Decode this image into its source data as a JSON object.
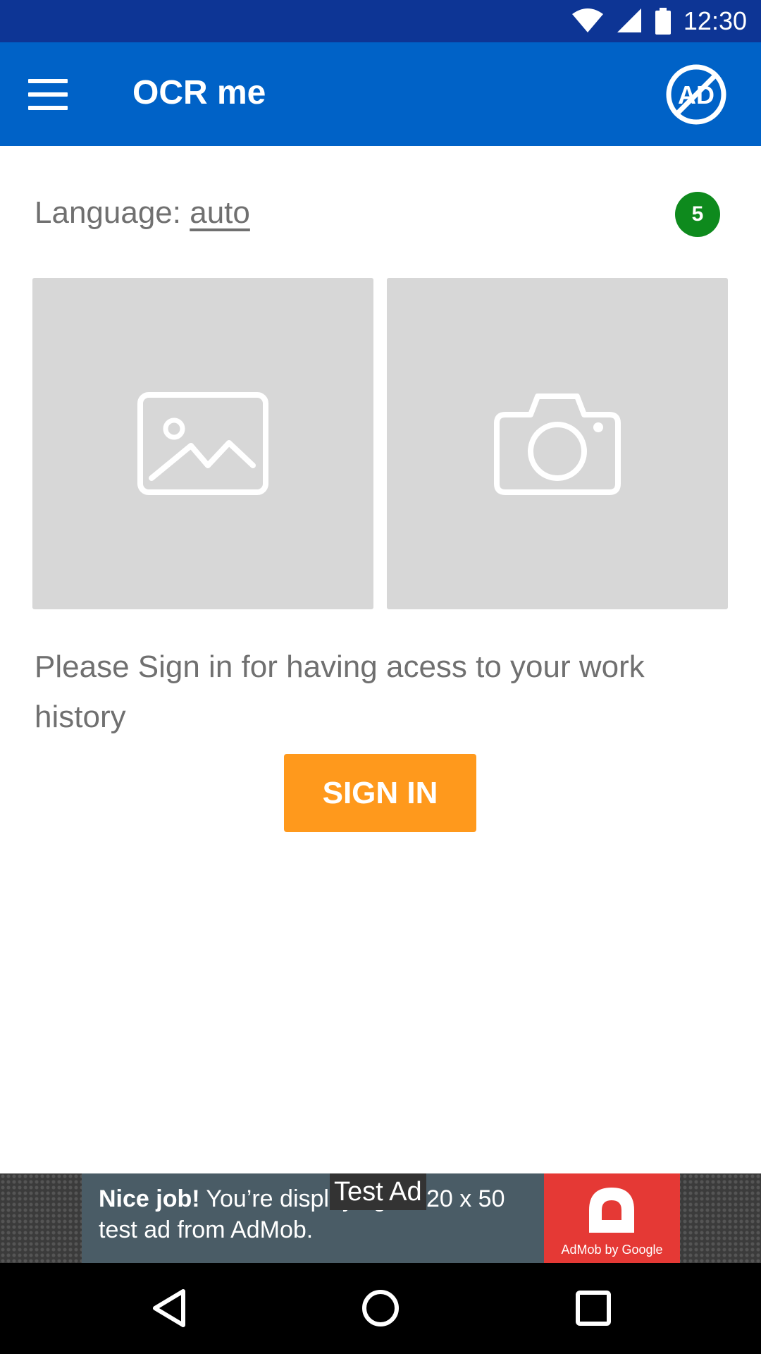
{
  "status_bar": {
    "time": "12:30",
    "icons": [
      "wifi-icon",
      "signal-icon",
      "battery-icon"
    ]
  },
  "app_bar": {
    "title": "OCR me",
    "menu_icon": "hamburger-menu-icon",
    "action_icon": "no-ads-icon",
    "action_icon_text": "AD"
  },
  "content": {
    "language_label": "Language:",
    "language_value": "auto",
    "count_badge": "5",
    "tiles": [
      {
        "name": "gallery",
        "icon": "image-icon"
      },
      {
        "name": "camera",
        "icon": "camera-icon"
      }
    ],
    "signin_message": "Please Sign in for having acess to your work history",
    "signin_button": "SIGN IN"
  },
  "ad": {
    "headline": "Nice job!",
    "body": "You’re displaying a 320 x 50 test ad from AdMob.",
    "label": "Test Ad",
    "logo_caption": "AdMob by Google"
  },
  "nav_bar": {
    "buttons": [
      "back-icon",
      "home-icon",
      "recents-icon"
    ]
  },
  "colors": {
    "status_bar": "#0d3595",
    "app_bar": "#0062c7",
    "accent": "#ff991c",
    "badge": "#0e8a1d",
    "tile": "#d7d7d7"
  }
}
